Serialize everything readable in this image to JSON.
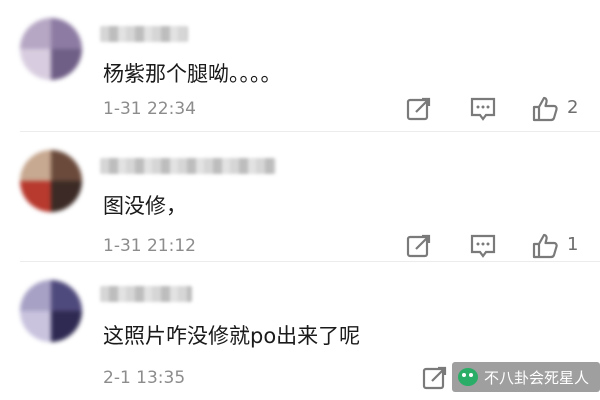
{
  "comments": [
    {
      "text": "杨紫那个腿呦。。。。",
      "time": "1-31 22:34",
      "like_count": "2",
      "avatar_colors": [
        "#b6a7c4",
        "#8d7ba3",
        "#d8cde0",
        "#6f5e86"
      ]
    },
    {
      "text": "图没修，",
      "time": "1-31 21:12",
      "like_count": "1",
      "avatar_colors": [
        "#c7a890",
        "#6b4a3b",
        "#b8392e",
        "#3b2a25"
      ]
    },
    {
      "text": "这照片咋没修就po出来了呢",
      "time": "2-1 13:35",
      "like_count": "",
      "avatar_colors": [
        "#a7a1c5",
        "#4f4a7d",
        "#c9c3de",
        "#2e2a52"
      ]
    }
  ],
  "watermark": {
    "text": "不八卦会死星人"
  },
  "icons": {
    "share": "share-icon",
    "comment": "comment-icon",
    "like": "thumbs-up-icon"
  },
  "colors": {
    "text": "#1a1a1a",
    "time": "#8c8c8c",
    "icon": "#7a7a7a"
  }
}
